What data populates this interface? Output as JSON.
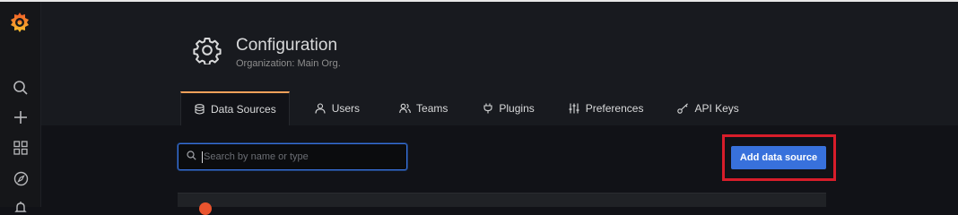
{
  "sidebar": {
    "items": [
      {
        "icon": "search-icon"
      },
      {
        "icon": "plus-icon"
      },
      {
        "icon": "dashboards-grid-icon"
      },
      {
        "icon": "explore-compass-icon"
      },
      {
        "icon": "alert-bell-icon"
      }
    ]
  },
  "header": {
    "title": "Configuration",
    "subtitle": "Organization: Main Org.",
    "icon": "gear-icon"
  },
  "tabs": [
    {
      "label": "Data Sources",
      "icon": "database-icon",
      "active": true
    },
    {
      "label": "Users",
      "icon": "user-icon",
      "active": false
    },
    {
      "label": "Teams",
      "icon": "users-icon",
      "active": false
    },
    {
      "label": "Plugins",
      "icon": "plug-icon",
      "active": false
    },
    {
      "label": "Preferences",
      "icon": "sliders-icon",
      "active": false
    },
    {
      "label": "API Keys",
      "icon": "key-icon",
      "active": false
    }
  ],
  "main": {
    "search": {
      "placeholder": "Search by name or type",
      "value": ""
    },
    "add_button_label": "Add data source"
  },
  "colors": {
    "accent": "#f5a05a",
    "primary_button": "#3871dc",
    "highlight": "#d81d2a",
    "background": "#111217"
  }
}
